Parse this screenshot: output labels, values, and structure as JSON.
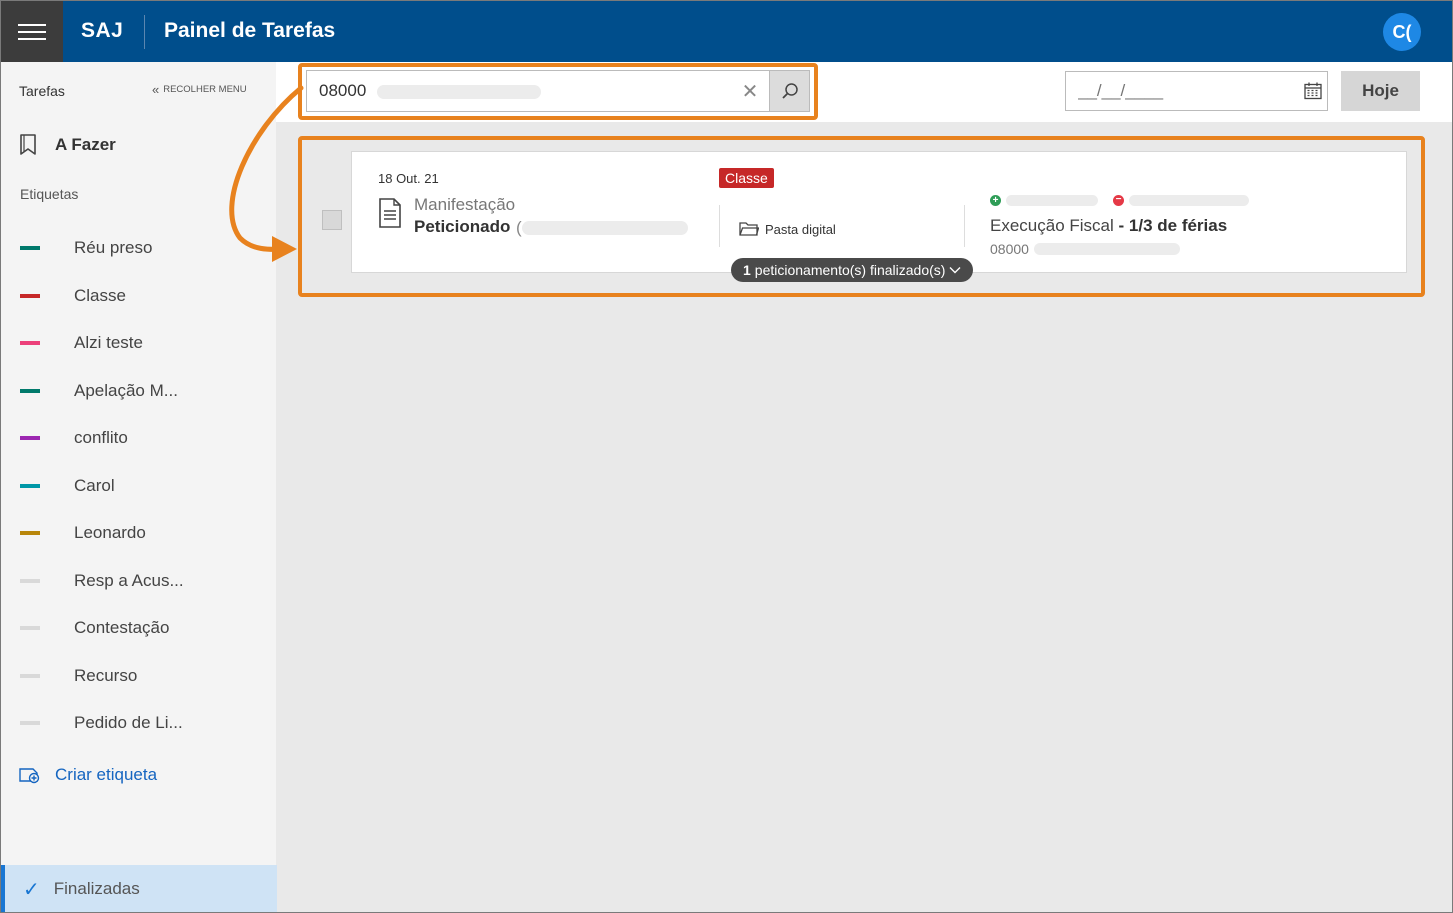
{
  "header": {
    "brand": "SAJ",
    "title": "Painel de Tarefas",
    "user_initials": "C("
  },
  "sidebar": {
    "title": "Tarefas",
    "collapse_label": "RECOLHER MENU",
    "todo_label": "A Fazer",
    "tags_title": "Etiquetas",
    "tags": [
      {
        "label": "Réu preso",
        "color": "#00796b"
      },
      {
        "label": "Classe",
        "color": "#c62828"
      },
      {
        "label": "Alzi teste",
        "color": "#ec407a"
      },
      {
        "label": "Apelação M...",
        "color": "#00796b"
      },
      {
        "label": "conflito",
        "color": "#9c27b0"
      },
      {
        "label": "Carol",
        "color": "#0097a7"
      },
      {
        "label": "Leonardo",
        "color": "#b8860b"
      },
      {
        "label": "Resp a Acus...",
        "color": "#d9d9d9"
      },
      {
        "label": "Contestação",
        "color": "#d9d9d9"
      },
      {
        "label": "Recurso",
        "color": "#d9d9d9"
      },
      {
        "label": "Pedido de Li...",
        "color": "#d9d9d9"
      }
    ],
    "create_tag_label": "Criar etiqueta",
    "finalized_label": "Finalizadas"
  },
  "toolbar": {
    "search_value": "08000",
    "date_placeholder": "__/__/____",
    "today_label": "Hoje"
  },
  "task": {
    "date": "18 Out. 21",
    "type": "Manifestação",
    "status": "Peticionado",
    "status_paren": "(",
    "badge": "Classe",
    "badge_color": "#c62828",
    "folder_label": "Pasta digital",
    "class_label": "Execução Fiscal",
    "class_detail": "- 1/3 de férias",
    "process_number": "08000",
    "finalized_count": "1",
    "finalized_text": "peticionamento(s) finalizado(s)"
  },
  "highlight_color": "#e8821e"
}
